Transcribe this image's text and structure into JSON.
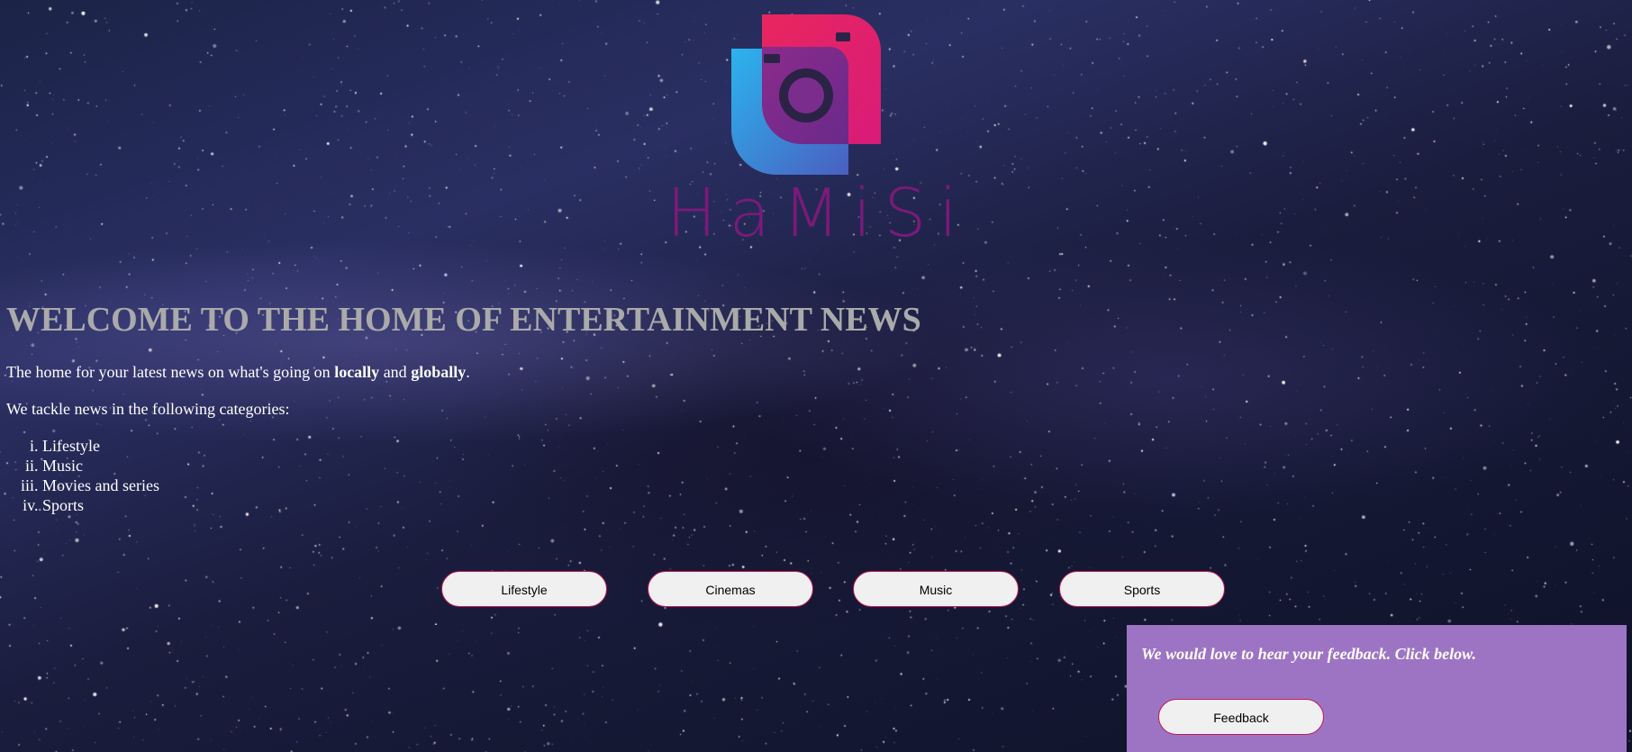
{
  "brand": {
    "name": "HaMiSi",
    "logo_icon": "camera-icon",
    "colors": {
      "pink": "#e91e63",
      "purple": "#7b2d8e",
      "blue": "#29b6f6",
      "text": "#7b1a78"
    }
  },
  "main": {
    "heading": "WELCOME TO THE HOME OF ENTERTAINMENT NEWS",
    "intro": {
      "prefix": "The home for your latest news on what's going on ",
      "locally": "locally",
      "and": " and ",
      "globally": "globally",
      "suffix": "."
    },
    "categories_intro": "We tackle news in the following categories:",
    "categories": [
      "Lifestyle",
      "Music",
      "Movies and series",
      "Sports"
    ]
  },
  "nav": {
    "buttons": [
      "Lifestyle",
      "Cinemas",
      "Music",
      "Sports"
    ]
  },
  "feedback": {
    "message": "We would love to hear your feedback. Click below.",
    "button": "Feedback",
    "bg_color": "#9d74c3"
  }
}
